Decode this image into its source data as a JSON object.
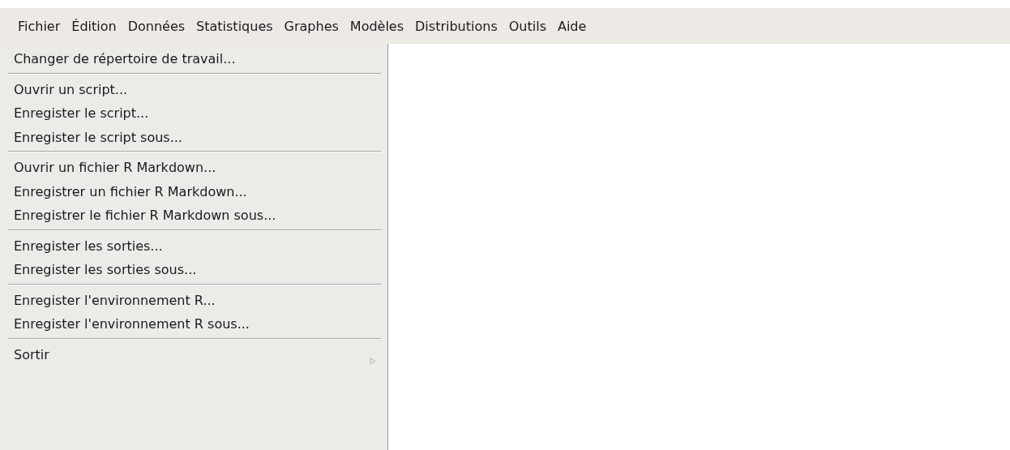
{
  "menubar": [
    "Fichier",
    "Édition",
    "Données",
    "Statistiques",
    "Graphes",
    "Modèles",
    "Distributions",
    "Outils",
    "Aide"
  ],
  "menu": {
    "groups": [
      [
        {
          "label": "Changer de répertoire de travail...",
          "submenu": false
        }
      ],
      [
        {
          "label": "Ouvrir un script...",
          "submenu": false
        },
        {
          "label": "Enregister le script...",
          "submenu": false
        },
        {
          "label": "Enregister le script sous...",
          "submenu": false
        }
      ],
      [
        {
          "label": "Ouvrir un fichier R Markdown...",
          "submenu": false
        },
        {
          "label": "Enregistrer un fichier R Markdown...",
          "submenu": false
        },
        {
          "label": "Enregistrer le fichier R Markdown sous...",
          "submenu": false
        }
      ],
      [
        {
          "label": "Enregister les sorties...",
          "submenu": false
        },
        {
          "label": "Enregister les sorties sous...",
          "submenu": false
        }
      ],
      [
        {
          "label": "Enregister l'environnement R...",
          "submenu": false
        },
        {
          "label": "Enregister l'environnement R sous...",
          "submenu": false
        }
      ],
      [
        {
          "label": "Sortir",
          "submenu": true
        }
      ]
    ]
  }
}
